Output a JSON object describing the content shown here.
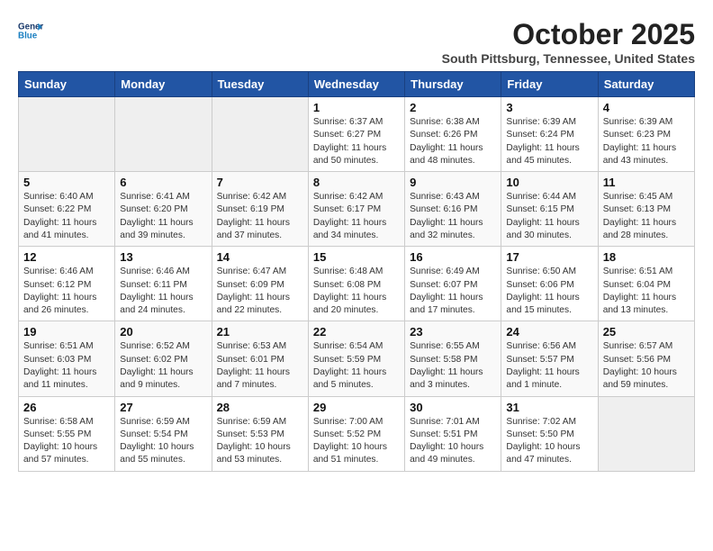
{
  "header": {
    "logo_general": "General",
    "logo_blue": "Blue",
    "month": "October 2025",
    "location": "South Pittsburg, Tennessee, United States"
  },
  "days_of_week": [
    "Sunday",
    "Monday",
    "Tuesday",
    "Wednesday",
    "Thursday",
    "Friday",
    "Saturday"
  ],
  "weeks": [
    [
      {
        "day": "",
        "text": ""
      },
      {
        "day": "",
        "text": ""
      },
      {
        "day": "",
        "text": ""
      },
      {
        "day": "1",
        "text": "Sunrise: 6:37 AM\nSunset: 6:27 PM\nDaylight: 11 hours and 50 minutes."
      },
      {
        "day": "2",
        "text": "Sunrise: 6:38 AM\nSunset: 6:26 PM\nDaylight: 11 hours and 48 minutes."
      },
      {
        "day": "3",
        "text": "Sunrise: 6:39 AM\nSunset: 6:24 PM\nDaylight: 11 hours and 45 minutes."
      },
      {
        "day": "4",
        "text": "Sunrise: 6:39 AM\nSunset: 6:23 PM\nDaylight: 11 hours and 43 minutes."
      }
    ],
    [
      {
        "day": "5",
        "text": "Sunrise: 6:40 AM\nSunset: 6:22 PM\nDaylight: 11 hours and 41 minutes."
      },
      {
        "day": "6",
        "text": "Sunrise: 6:41 AM\nSunset: 6:20 PM\nDaylight: 11 hours and 39 minutes."
      },
      {
        "day": "7",
        "text": "Sunrise: 6:42 AM\nSunset: 6:19 PM\nDaylight: 11 hours and 37 minutes."
      },
      {
        "day": "8",
        "text": "Sunrise: 6:42 AM\nSunset: 6:17 PM\nDaylight: 11 hours and 34 minutes."
      },
      {
        "day": "9",
        "text": "Sunrise: 6:43 AM\nSunset: 6:16 PM\nDaylight: 11 hours and 32 minutes."
      },
      {
        "day": "10",
        "text": "Sunrise: 6:44 AM\nSunset: 6:15 PM\nDaylight: 11 hours and 30 minutes."
      },
      {
        "day": "11",
        "text": "Sunrise: 6:45 AM\nSunset: 6:13 PM\nDaylight: 11 hours and 28 minutes."
      }
    ],
    [
      {
        "day": "12",
        "text": "Sunrise: 6:46 AM\nSunset: 6:12 PM\nDaylight: 11 hours and 26 minutes."
      },
      {
        "day": "13",
        "text": "Sunrise: 6:46 AM\nSunset: 6:11 PM\nDaylight: 11 hours and 24 minutes."
      },
      {
        "day": "14",
        "text": "Sunrise: 6:47 AM\nSunset: 6:09 PM\nDaylight: 11 hours and 22 minutes."
      },
      {
        "day": "15",
        "text": "Sunrise: 6:48 AM\nSunset: 6:08 PM\nDaylight: 11 hours and 20 minutes."
      },
      {
        "day": "16",
        "text": "Sunrise: 6:49 AM\nSunset: 6:07 PM\nDaylight: 11 hours and 17 minutes."
      },
      {
        "day": "17",
        "text": "Sunrise: 6:50 AM\nSunset: 6:06 PM\nDaylight: 11 hours and 15 minutes."
      },
      {
        "day": "18",
        "text": "Sunrise: 6:51 AM\nSunset: 6:04 PM\nDaylight: 11 hours and 13 minutes."
      }
    ],
    [
      {
        "day": "19",
        "text": "Sunrise: 6:51 AM\nSunset: 6:03 PM\nDaylight: 11 hours and 11 minutes."
      },
      {
        "day": "20",
        "text": "Sunrise: 6:52 AM\nSunset: 6:02 PM\nDaylight: 11 hours and 9 minutes."
      },
      {
        "day": "21",
        "text": "Sunrise: 6:53 AM\nSunset: 6:01 PM\nDaylight: 11 hours and 7 minutes."
      },
      {
        "day": "22",
        "text": "Sunrise: 6:54 AM\nSunset: 5:59 PM\nDaylight: 11 hours and 5 minutes."
      },
      {
        "day": "23",
        "text": "Sunrise: 6:55 AM\nSunset: 5:58 PM\nDaylight: 11 hours and 3 minutes."
      },
      {
        "day": "24",
        "text": "Sunrise: 6:56 AM\nSunset: 5:57 PM\nDaylight: 11 hours and 1 minute."
      },
      {
        "day": "25",
        "text": "Sunrise: 6:57 AM\nSunset: 5:56 PM\nDaylight: 10 hours and 59 minutes."
      }
    ],
    [
      {
        "day": "26",
        "text": "Sunrise: 6:58 AM\nSunset: 5:55 PM\nDaylight: 10 hours and 57 minutes."
      },
      {
        "day": "27",
        "text": "Sunrise: 6:59 AM\nSunset: 5:54 PM\nDaylight: 10 hours and 55 minutes."
      },
      {
        "day": "28",
        "text": "Sunrise: 6:59 AM\nSunset: 5:53 PM\nDaylight: 10 hours and 53 minutes."
      },
      {
        "day": "29",
        "text": "Sunrise: 7:00 AM\nSunset: 5:52 PM\nDaylight: 10 hours and 51 minutes."
      },
      {
        "day": "30",
        "text": "Sunrise: 7:01 AM\nSunset: 5:51 PM\nDaylight: 10 hours and 49 minutes."
      },
      {
        "day": "31",
        "text": "Sunrise: 7:02 AM\nSunset: 5:50 PM\nDaylight: 10 hours and 47 minutes."
      },
      {
        "day": "",
        "text": ""
      }
    ]
  ]
}
